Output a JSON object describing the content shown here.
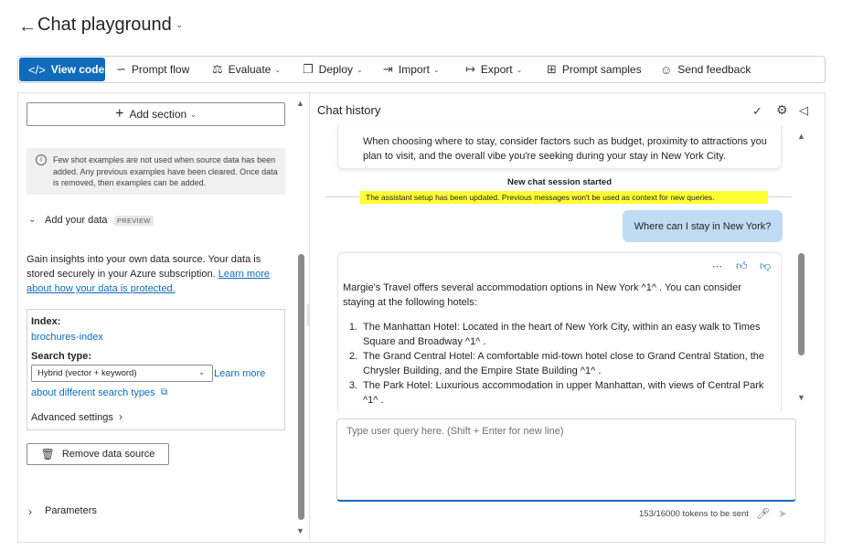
{
  "header": {
    "back_icon": "arrow-left-icon",
    "title": "Chat playground"
  },
  "toolbar": {
    "view_code": "View code",
    "prompt_flow": "Prompt flow",
    "evaluate": "Evaluate",
    "deploy": "Deploy",
    "import": "Import",
    "export": "Export",
    "prompt_samples": "Prompt samples",
    "send_feedback": "Send feedback",
    "accent_color": "#0f6cbd"
  },
  "left": {
    "add_section": "Add section",
    "info_text": "Few shot examples are not used when source data has been added. Any previous examples have been cleared. Once data is removed, then examples can be added.",
    "add_your_data": "Add your data",
    "preview_badge": "PREVIEW",
    "insights_text": "Gain insights into your own data source. Your data is stored securely in your Azure subscription.",
    "insights_link": "Learn more about how your data is protected.",
    "index_label": "Index:",
    "index_value": "brochures-index",
    "search_type_label": "Search type:",
    "search_type_value": "Hybrid (vector + keyword)",
    "learn_more": "Learn more",
    "learn_more_2": "about different search types",
    "advanced_settings": "Advanced settings",
    "remove_data_source": "Remove data source",
    "parameters": "Parameters"
  },
  "chat": {
    "title": "Chat history",
    "assistant_msg_1": "When choosing where to stay, consider factors such as budget, proximity to attractions you plan to visit, and the overall vibe you're seeking during your stay in New York City.",
    "session_started": "New chat session started",
    "setup_updated": "The assistant setup has been updated. Previous messages won't be used as context for new queries.",
    "user_msg": "Where can I stay in New York?",
    "assistant_msg_2_intro": "Margie's Travel offers several accommodation options in New York ^1^ . You can consider staying at the following hotels:",
    "hotels": [
      {
        "num": "1.",
        "text": "The Manhattan Hotel: Located in the heart of New York City, within an easy walk to Times Square and Broadway ^1^ ."
      },
      {
        "num": "2.",
        "text": "The Grand Central Hotel: A comfortable mid-town hotel close to Grand Central Station, the Chrysler Building, and the Empire State Building ^1^ ."
      },
      {
        "num": "3.",
        "text": "The Park Hotel: Luxurious accommodation in upper Manhattan, with views of Central Park ^1^ ."
      }
    ],
    "input_placeholder": "Type user query here. (Shift + Enter for new line)",
    "token_count": "153/16000 tokens to be sent",
    "highlight_color": "#ffff33",
    "user_bubble_color": "#bfdcf4"
  }
}
